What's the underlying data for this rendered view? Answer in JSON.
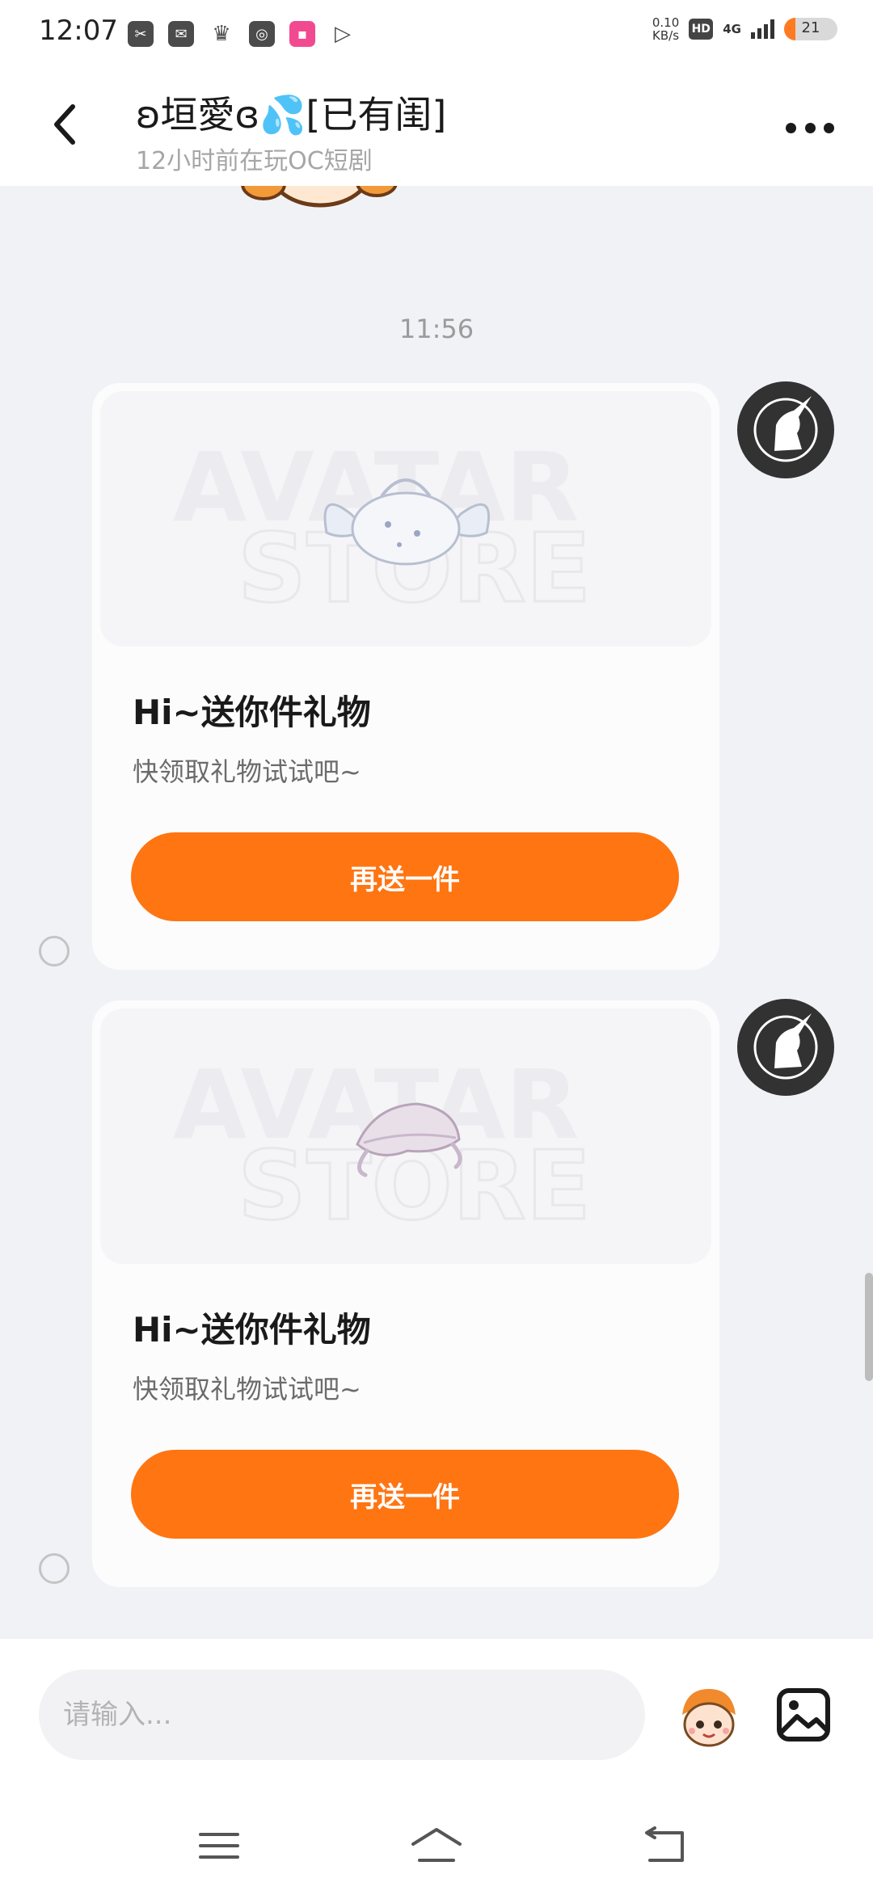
{
  "status_bar": {
    "time": "12:07",
    "app_icons": [
      "scissors-app-icon",
      "mail-app-icon",
      "crown-app-icon",
      "search-app-icon",
      "bilibili-app-icon",
      "play-app-icon"
    ],
    "net_speed_value": "0.10",
    "net_speed_unit": "KB/s",
    "hd_label": "HD",
    "network_label": "4G",
    "battery_level": "21"
  },
  "header": {
    "chat_name": "ʚ垣愛ɞ💦[已有闺]",
    "chat_status": "12小时前在玩OC短剧"
  },
  "chat": {
    "timestamp": "11:56",
    "messages": [
      {
        "title": "Hi~送你件礼物",
        "subtitle": "快领取礼物试试吧~",
        "button_label": "再送一件",
        "banner_watermark": [
          "AVATAR",
          "STORE"
        ],
        "gift_item": "winged-bag-item"
      },
      {
        "title": "Hi~送你件礼物",
        "subtitle": "快领取礼物试试吧~",
        "button_label": "再送一件",
        "banner_watermark": [
          "AVATAR",
          "STORE"
        ],
        "gift_item": "ruffled-bonnet-item"
      }
    ]
  },
  "input_bar": {
    "placeholder": "请输入..."
  },
  "colors": {
    "accent": "#ff7512",
    "background": "#f1f2f6",
    "card": "#fcfcfd",
    "avatar": "#323232"
  },
  "icons": {
    "back": "back-arrow-icon",
    "more": "more-dots-icon",
    "sticker": "sticker-face-icon",
    "image": "image-picker-icon",
    "nav_menu": "menu-icon",
    "nav_home": "home-icon",
    "nav_back": "back-nav-icon"
  }
}
